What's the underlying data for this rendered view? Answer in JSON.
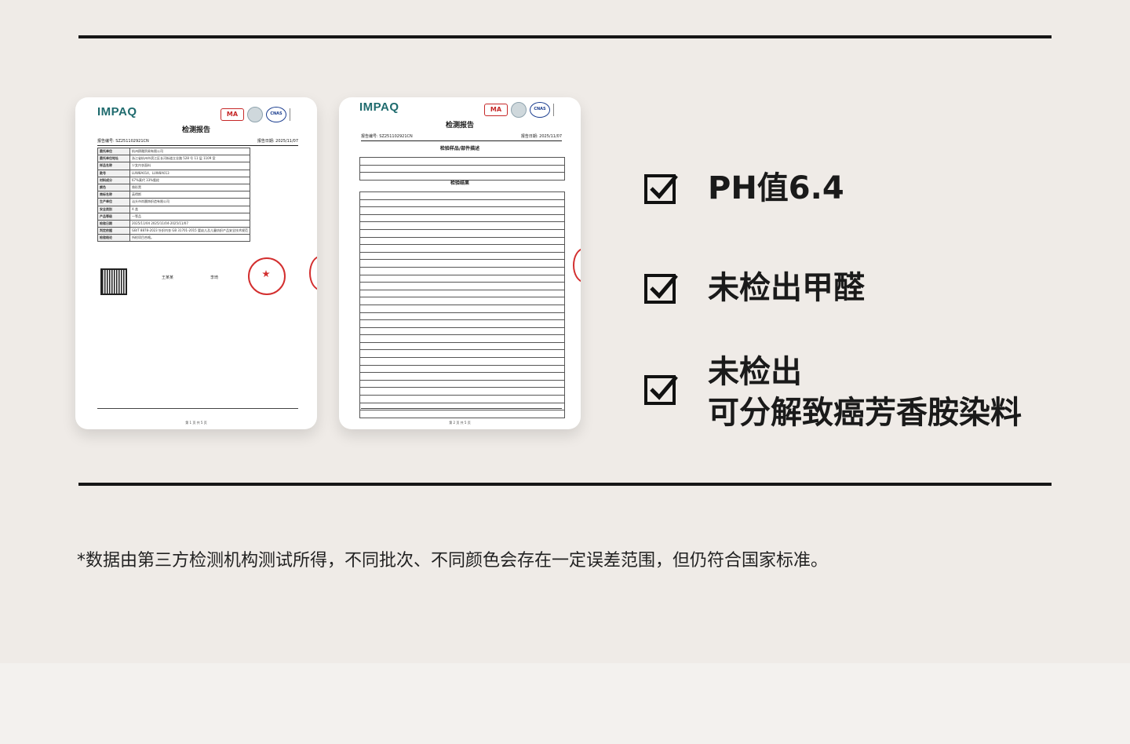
{
  "features": [
    {
      "text": "PH值6.4"
    },
    {
      "text_line1": "未检出甲醛"
    },
    {
      "text_line1": "未检出",
      "text_line2": "可分解致癌芳香胺染料"
    }
  ],
  "note": "*数据由第三方检测机构测试所得，不同批次、不同颜色会存在一定误差范围，但仍符合国家标准。",
  "documents": [
    {
      "logo": "IMPAQ",
      "cert_ma": "MA",
      "cert_cnas": "CNAS",
      "title": "检测报告",
      "report_no": "报告编号: SZ251102921CN",
      "report_date": "报告日期: 2025/11/07",
      "rows": [
        [
          "委托单位",
          "杭州鸥雅贸易有限公司"
        ],
        [
          "委托单位地址",
          "浙江省杭州市滨江区长河街道立业路 528 号 11 层 1109 室"
        ],
        [
          "样品名称",
          "少女内衣面料"
        ],
        [
          "款号",
          "LUW8A014、LUW8A013"
        ],
        [
          "材料成分",
          "67%莫代 33%氨纶"
        ],
        [
          "颜色",
          "隐形黑"
        ],
        [
          "商标名称",
          "英得斯"
        ],
        [
          "生产单位",
          "汕头市尚晨饰织造有限公司"
        ],
        [
          "安全类别",
          "A 类"
        ],
        [
          "产品等级",
          "一等品"
        ],
        [
          "检验日期",
          "2025/11/04   2025/11/04-2025/11/07"
        ],
        [
          "判定依据",
          "GB/T 8878-2023  针织内衣  GB 31701-2015 婴幼儿及儿童纺织产品安全技术规范"
        ],
        [
          "检验结论",
          "所检项目合格。"
        ]
      ],
      "signers": [
        "王某某",
        "李琦"
      ],
      "page": "第 1 页 共 5 页"
    },
    {
      "logo": "IMPAQ",
      "cert_ma": "MA",
      "cert_cnas": "CNAS",
      "title": "检测报告",
      "report_no": "报告编号: SZ251102921CN",
      "report_date": "报告日期: 2025/11/07",
      "section1": "检验样品/部件描述",
      "section2": "检验结果",
      "page": "第 2 页 共 5 页"
    }
  ]
}
